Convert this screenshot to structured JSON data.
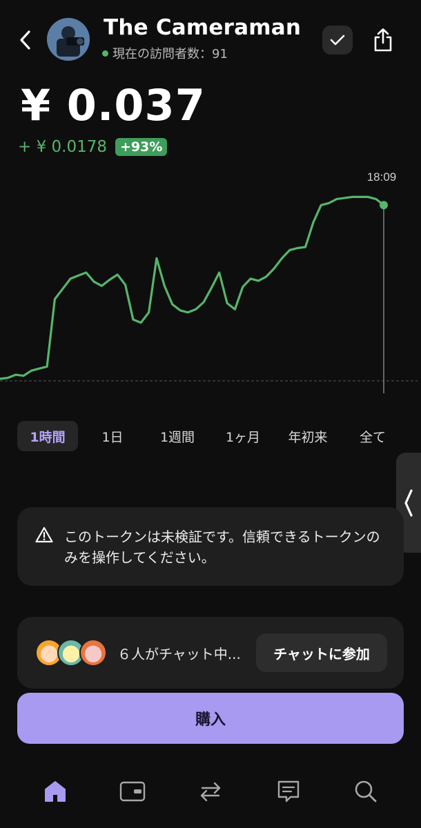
{
  "header": {
    "title": "The Cameraman",
    "visitors_text": "現在の訪問者数：91"
  },
  "price": {
    "value": "¥ 0.037",
    "change_abs": "+ ¥ 0.0178",
    "change_pct": "+93%"
  },
  "chart_data": {
    "type": "line",
    "tooltip_time": "18:09",
    "color": "#57b56c",
    "baseline": "dashed",
    "x": [
      0,
      1,
      2,
      3,
      4,
      5,
      6,
      7,
      8,
      9,
      10,
      11,
      12,
      13,
      14,
      15,
      16,
      17,
      18,
      19,
      20,
      21,
      22,
      23,
      24,
      25,
      26,
      27,
      28,
      29,
      30,
      31,
      32,
      33,
      34,
      35,
      36,
      37,
      38,
      39,
      40,
      41,
      42,
      43,
      44,
      45,
      46,
      47,
      48,
      49
    ],
    "values": [
      0.0192,
      0.0193,
      0.0196,
      0.0195,
      0.02,
      0.0202,
      0.0204,
      0.027,
      0.028,
      0.029,
      0.0293,
      0.0296,
      0.0287,
      0.0283,
      0.0289,
      0.0294,
      0.0284,
      0.025,
      0.0247,
      0.0257,
      0.031,
      0.0283,
      0.0265,
      0.0259,
      0.0257,
      0.026,
      0.0267,
      0.0281,
      0.0296,
      0.0266,
      0.026,
      0.0282,
      0.029,
      0.0288,
      0.0292,
      0.03,
      0.031,
      0.0318,
      0.032,
      0.0321,
      0.0345,
      0.0362,
      0.0364,
      0.0368,
      0.0369,
      0.037,
      0.037,
      0.037,
      0.0368,
      0.0362
    ]
  },
  "timeframes": [
    "1時間",
    "1日",
    "1週間",
    "1ヶ月",
    "年初来",
    "全て"
  ],
  "timeframe_active": "1時間",
  "warning": {
    "text": "このトークンは未検証です。信頼できるトークンのみを操作してください。"
  },
  "chat": {
    "text": "６人がチャット中...",
    "join_label": "チャットに参加"
  },
  "buy_label": "購入",
  "colors": {
    "accent": "#a89af0",
    "positive": "#57b56c",
    "background": "#0e0e0e",
    "card": "#1f1f1f"
  },
  "nav_icons": [
    "home-icon",
    "wallet-icon",
    "swap-icon",
    "chat-icon",
    "search-icon"
  ]
}
